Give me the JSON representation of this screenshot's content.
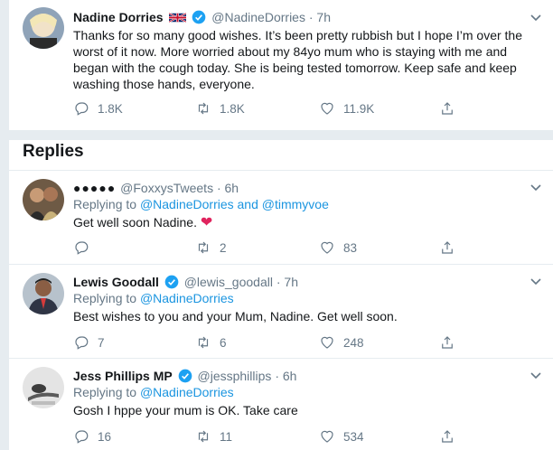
{
  "main_tweet": {
    "name": "Nadine Dorries",
    "handle": "@NadineDorries",
    "time": "· 7h",
    "text": "Thanks for so many good wishes. It’s been pretty rubbish but I hope I’m over the worst of it now. More worried about my 84yo mum who is staying with me and began with the cough today. She is being tested tomorrow. Keep safe and keep washing those hands, everyone.",
    "replies": "1.8K",
    "retweets": "1.8K",
    "likes": "11.9K"
  },
  "replies_section": {
    "title": "Replies"
  },
  "replies": [
    {
      "name": "➊➋➌➍➎",
      "name_display": "●●●●●",
      "handle": "@FoxxysTweets",
      "time": "· 6h",
      "replying_prefix": "Replying to",
      "replying_to": "@NadineDorries and @timmyvoe",
      "text": "Get well soon Nadine.",
      "reply_count": "",
      "retweet_count": "2",
      "like_count": "83"
    },
    {
      "name": "Lewis Goodall",
      "handle": "@lewis_goodall",
      "time": "· 7h",
      "replying_prefix": "Replying to",
      "replying_to": "@NadineDorries",
      "text": "Best wishes to you and your Mum, Nadine. Get well soon.",
      "reply_count": "7",
      "retweet_count": "6",
      "like_count": "248"
    },
    {
      "name": "Jess Phillips MP",
      "handle": "@jessphillips",
      "time": "· 6h",
      "replying_prefix": "Replying to",
      "replying_to": "@NadineDorries",
      "text": "Gosh I hppe your mum is OK. Take care",
      "reply_count": "16",
      "retweet_count": "11",
      "like_count": "534"
    }
  ],
  "colors": {
    "link": "#1b95e0",
    "verified": "#1da1f2",
    "heart": "#e0245e",
    "muted": "#657786"
  }
}
